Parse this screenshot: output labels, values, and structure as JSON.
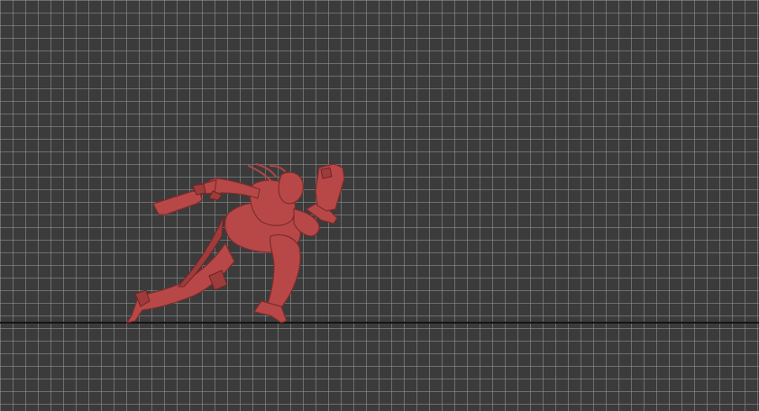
{
  "viewport": {
    "background_color": "#3b3b3b",
    "grid_color": "#969696",
    "ground_line_color": "#151515"
  },
  "model": {
    "pose": "running",
    "held_items": [
      "pistol-left",
      "pistol-right"
    ],
    "material_color": "#b84848"
  }
}
